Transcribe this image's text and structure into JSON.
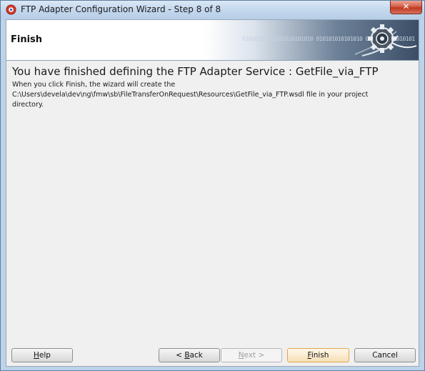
{
  "window": {
    "title": "FTP Adapter Configuration Wizard - Step 8 of 8",
    "close_label": "✕"
  },
  "banner": {
    "title": "Finish",
    "bits": "01010101010101010101010 010101010101010 0101010101010101"
  },
  "content": {
    "heading": "You have finished defining the FTP Adapter Service : GetFile_via_FTP",
    "line1": "When you click Finish, the wizard will create the",
    "line2": "C:\\Users\\devela\\dev\\ng\\fmw\\sb\\FileTransferOnRequest\\Resources\\GetFile_via_FTP.wsdl file in your project",
    "line3": "directory."
  },
  "buttons": {
    "help_first": "H",
    "help_rest": "elp",
    "back_prefix": "< ",
    "back_accel": "B",
    "back_rest": "ack",
    "next_accel": "N",
    "next_rest": "ext >",
    "finish_accel": "F",
    "finish_rest": "inish",
    "cancel": "Cancel"
  },
  "colors": {
    "window_frame": "#bcd3ea",
    "client_bg": "#f0f0f0",
    "close_red": "#c0391f",
    "default_button_border": "#e2a84a"
  }
}
